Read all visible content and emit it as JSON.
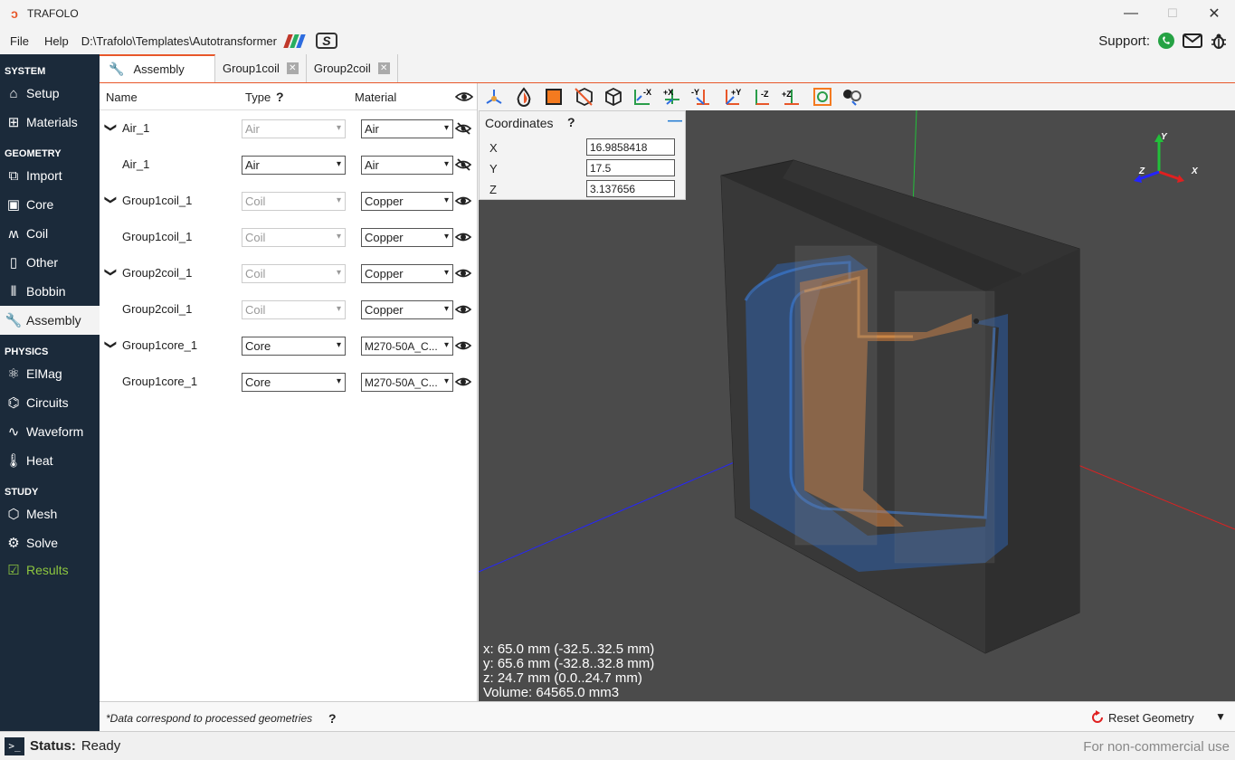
{
  "window": {
    "title": "TRAFOLO",
    "minimize": "—",
    "maximize": "☐",
    "close": "✕"
  },
  "menu": {
    "file": "File",
    "help": "Help",
    "path": "D:\\Trafolo\\Templates\\Autotransformer"
  },
  "support": {
    "label": "Support:"
  },
  "sidebar": {
    "system": "SYSTEM",
    "setup": "Setup",
    "materials": "Materials",
    "geometry": "GEOMETRY",
    "import": "Import",
    "core": "Core",
    "coil": "Coil",
    "other": "Other",
    "bobbin": "Bobbin",
    "assembly": "Assembly",
    "physics": "PHYSICS",
    "elmag": "ElMag",
    "circuits": "Circuits",
    "waveform": "Waveform",
    "heat": "Heat",
    "study": "STUDY",
    "mesh": "Mesh",
    "solve": "Solve",
    "results": "Results"
  },
  "tabs": [
    {
      "label": "Assembly"
    },
    {
      "label": "Group1coil"
    },
    {
      "label": "Group2coil"
    }
  ],
  "table": {
    "headers": {
      "name": "Name",
      "type": "Type",
      "type_help": "?",
      "material": "Material"
    },
    "rows": [
      {
        "name": "Air_1",
        "type": "Air",
        "material": "Air",
        "expand": "❯"
      },
      {
        "name": "Air_1",
        "type": "Air",
        "material": "Air"
      },
      {
        "name": "Group1coil_1",
        "type": "Coil",
        "material": "Copper",
        "expand": "❯"
      },
      {
        "name": "Group1coil_1",
        "type": "Coil",
        "material": "Copper"
      },
      {
        "name": "Group2coil_1",
        "type": "Coil",
        "material": "Copper",
        "expand": "❯"
      },
      {
        "name": "Group2coil_1",
        "type": "Coil",
        "material": "Copper"
      },
      {
        "name": "Group1core_1",
        "type": "Core",
        "material": "M270-50A_C...",
        "expand": "❯"
      },
      {
        "name": "Group1core_1",
        "type": "Core",
        "material": "M270-50A_C..."
      }
    ]
  },
  "footer": {
    "note": "*Data correspond to processed geometries",
    "help": "?",
    "reset": "Reset Geometry"
  },
  "status": {
    "label": "Status:",
    "value": "Ready",
    "license": "For non-commercial use"
  },
  "toolbar": {
    "x_minus": "-X",
    "x_plus": "+X",
    "y_minus": "-Y",
    "y_plus": "+Y",
    "z_minus": "-Z",
    "z_plus": "+Z"
  },
  "coordinates": {
    "title": "Coordinates",
    "help": "?",
    "minimize": "—",
    "x_label": "X",
    "x": "16.9858418",
    "y_label": "Y",
    "y": "17.5",
    "z_label": "Z",
    "z": "3.137656"
  },
  "axes": {
    "x": "X",
    "y": "Y",
    "z": "Z"
  },
  "dimensions": {
    "x": "x: 65.0 mm (-32.5..32.5 mm)",
    "y": "y: 65.6 mm (-32.8..32.8 mm)",
    "z": "z: 24.7 mm (0.0..24.7 mm)",
    "volume": "Volume: 64565.0 mm3"
  },
  "colors": {
    "accent": "#e8572a",
    "sidebar": "#1b2a3a",
    "results": "#8dc63f",
    "viewport": "#4b4b4b"
  }
}
